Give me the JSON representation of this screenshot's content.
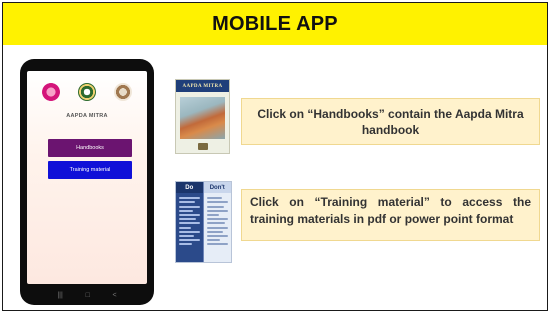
{
  "slide": {
    "title": "MOBILE APP"
  },
  "phone": {
    "app_title": "AAPDA MITRA",
    "logos": [
      "logo-1",
      "logo-2",
      "logo-3"
    ],
    "buttons": {
      "handbooks": "Handbooks",
      "training": "Training material"
    },
    "nav": {
      "recent": "|||",
      "home": "□",
      "back": "<"
    },
    "colors": {
      "handbooks_button": "#6b1470",
      "training_button": "#1010d8"
    }
  },
  "thumbnails": {
    "handbook_cover_title": "AAPDA MITRA",
    "dos_label": "Do",
    "donts_label": "Don't"
  },
  "callouts": {
    "handbooks": "Click on “Handbooks” contain the  Aapda Mitra handbook",
    "training": "Click on “Training material” to access the training materials in pdf or power point format"
  },
  "colors": {
    "title_bar": "#fff200",
    "callout_bg": "#fff2cc"
  }
}
